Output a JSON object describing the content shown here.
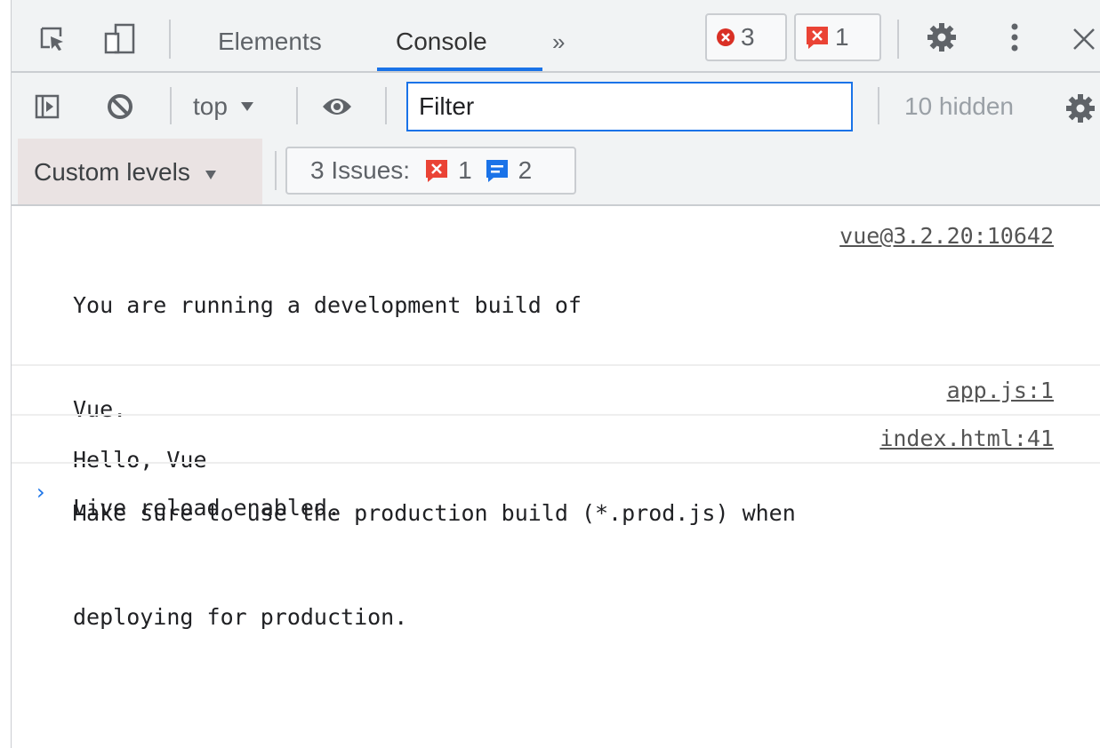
{
  "tabbar": {
    "tabs": [
      {
        "label": "Elements"
      },
      {
        "label": "Console"
      }
    ],
    "more_tabs_glyph": "»",
    "error_count": "3",
    "issue_count": "1",
    "icons": {
      "inspect": "inspect-element-icon",
      "device": "device-toolbar-icon",
      "settings": "gear-icon",
      "menu": "more-vertical-icon",
      "close": "close-icon"
    }
  },
  "toolbar": {
    "context": "top",
    "filter_placeholder": "Filter",
    "hidden_count": "10 hidden",
    "icons": {
      "sidebar": "show-sidebar-icon",
      "clear": "clear-console-icon",
      "live_expression": "eye-icon",
      "settings": "gear-icon"
    }
  },
  "levelsbar": {
    "custom_levels": "Custom levels",
    "issues_label": "3 Issues:",
    "issues_error_count": "1",
    "issues_info_count": "2"
  },
  "messages": [
    {
      "lines": [
        "You are running a development build of",
        "Vue.",
        "Make sure to use the production build (*.prod.js) when",
        "deploying for production."
      ],
      "source": "vue@3.2.20:10642"
    },
    {
      "lines": [
        "Hello, Vue"
      ],
      "source": "app.js:1"
    },
    {
      "lines": [
        "Live reload enabled."
      ],
      "source": "index.html:41"
    }
  ],
  "prompt_glyph": "›",
  "colors": {
    "accent": "#1a73e8",
    "error_red": "#d93025",
    "issue_red": "#ea4335",
    "info_blue": "#1a73e8",
    "toolbar_bg": "#f1f3f4"
  }
}
